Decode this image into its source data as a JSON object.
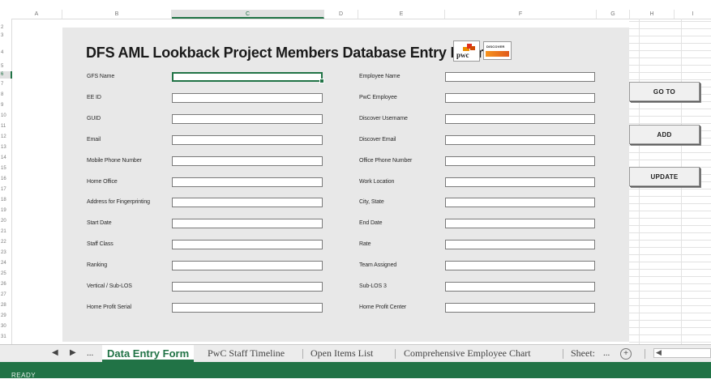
{
  "columns": [
    {
      "letter": "A"
    },
    {
      "letter": "B"
    },
    {
      "letter": "C"
    },
    {
      "letter": "D"
    },
    {
      "letter": "E"
    },
    {
      "letter": "F"
    },
    {
      "letter": "G"
    },
    {
      "letter": "H"
    },
    {
      "letter": "I"
    }
  ],
  "selected_column": "C",
  "rows": [
    "2",
    "3",
    "4",
    "5",
    "6",
    "7",
    "8",
    "9",
    "10",
    "11",
    "12",
    "13",
    "14",
    "15",
    "16",
    "17",
    "18",
    "19",
    "20",
    "21",
    "22",
    "23",
    "24",
    "25",
    "26",
    "27",
    "28",
    "29",
    "30",
    "31"
  ],
  "selected_row": "6",
  "form": {
    "title": "DFS AML Lookback Project Members Database Entry Form",
    "logos": {
      "pwc": "pwc",
      "discover": "DISCOVER"
    },
    "left_fields": [
      {
        "label": "GFS Name",
        "value": ""
      },
      {
        "label": "EE ID",
        "value": ""
      },
      {
        "label": "GUID",
        "value": ""
      },
      {
        "label": "Email",
        "value": ""
      },
      {
        "label": "Mobile Phone Number",
        "value": ""
      },
      {
        "label": "Home Office",
        "value": ""
      },
      {
        "label": "Address for Fingerprinting",
        "value": ""
      },
      {
        "label": "Start Date",
        "value": ""
      },
      {
        "label": "Staff Class",
        "value": ""
      },
      {
        "label": "Ranking",
        "value": ""
      },
      {
        "label": "Vertical / Sub-LOS",
        "value": ""
      },
      {
        "label": "Home Profit Serial",
        "value": ""
      }
    ],
    "right_fields": [
      {
        "label": "Employee Name",
        "value": ""
      },
      {
        "label": "PwC Employee",
        "value": ""
      },
      {
        "label": "Discover Username",
        "value": ""
      },
      {
        "label": "Discover Email",
        "value": ""
      },
      {
        "label": "Office Phone Number",
        "value": ""
      },
      {
        "label": "Work Location",
        "value": ""
      },
      {
        "label": "City, State",
        "value": ""
      },
      {
        "label": "End Date",
        "value": ""
      },
      {
        "label": "Rate",
        "value": ""
      },
      {
        "label": "Team Assigned",
        "value": ""
      },
      {
        "label": "Sub-LOS 3",
        "value": ""
      },
      {
        "label": "Home Profit Center",
        "value": ""
      }
    ],
    "buttons": {
      "goto": "GO TO",
      "add": "ADD",
      "update": "UPDATE"
    }
  },
  "sheet_tabs": {
    "ellipsis_left": "...",
    "tabs": [
      "Data Entry Form",
      "PwC Staff Timeline",
      "Open Items List",
      "Comprehensive Employee Chart",
      "Sheet:"
    ],
    "ellipsis_right": "...",
    "active_index": 0
  },
  "status": {
    "text": "READY"
  },
  "colors": {
    "accent": "#217346",
    "form_bg": "#e8e8e8"
  }
}
